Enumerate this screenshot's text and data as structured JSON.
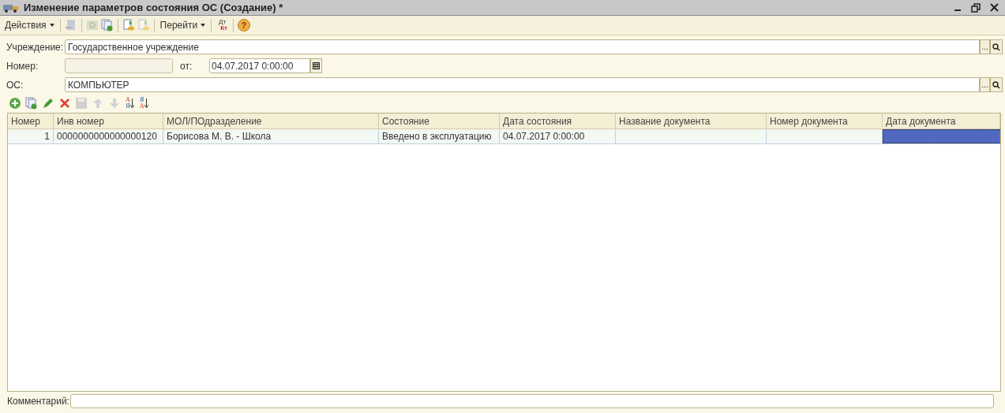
{
  "window": {
    "title": "Изменение параметров состояния ОС (Создание) *"
  },
  "toolbar": [
    {
      "kind": "menu",
      "label": "Действия"
    },
    {
      "kind": "sep"
    },
    {
      "kind": "icon",
      "disabled": true
    },
    {
      "kind": "sep"
    },
    {
      "kind": "icon",
      "disabled": true
    },
    {
      "kind": "icon",
      "disabled": false
    },
    {
      "kind": "sep"
    },
    {
      "kind": "icon",
      "disabled": false
    },
    {
      "kind": "icon",
      "disabled": true
    },
    {
      "kind": "sep"
    },
    {
      "kind": "menu",
      "label": "Перейти"
    },
    {
      "kind": "sep"
    },
    {
      "kind": "dtkt",
      "top": "Дт",
      "bottom": "Кт"
    },
    {
      "kind": "sep"
    },
    {
      "kind": "help",
      "label": "?"
    }
  ],
  "fields": {
    "institution": {
      "label": "Учреждение:",
      "value": "Государственное учреждение",
      "select_button": "..."
    },
    "number": {
      "label": "Номер:"
    },
    "date": {
      "label": "от:",
      "value": "04.07.2017  0:00:00"
    },
    "asset": {
      "label": "ОС:",
      "value": "КОМПЬЮТЕР",
      "select_button": "..."
    }
  },
  "table_toolbar": [
    {
      "kind": "icon",
      "disabled": false
    },
    {
      "kind": "icon",
      "disabled": false
    },
    {
      "kind": "icon",
      "disabled": false
    },
    {
      "kind": "icon",
      "disabled": false
    },
    {
      "kind": "icon",
      "disabled": true
    },
    {
      "kind": "icon",
      "disabled": true
    },
    {
      "kind": "icon",
      "disabled": true
    },
    {
      "kind": "sort",
      "top": "А",
      "bottom": "Я"
    },
    {
      "kind": "sort",
      "top": "Я",
      "bottom": "А"
    }
  ],
  "table": {
    "columns": [
      "Номер",
      "Инв номер",
      "МОЛ/ПОдразделение",
      "Состояние",
      "Дата состояния",
      "Название документа",
      "Номер документа",
      "Дата документа"
    ],
    "rows": [
      {
        "cells": [
          {
            "text": "1",
            "selected": false
          },
          {
            "text": "0000000000000000120",
            "selected": false
          },
          {
            "text": "Борисова М. В. - Школа",
            "selected": false
          },
          {
            "text": "Введено в эксплуатацию",
            "selected": false
          },
          {
            "text": "04.07.2017 0:00:00",
            "selected": false
          },
          {
            "selected": false
          },
          {
            "selected": false
          },
          {
            "selected": true
          }
        ]
      }
    ]
  },
  "comment": {
    "label": "Комментарий:"
  }
}
